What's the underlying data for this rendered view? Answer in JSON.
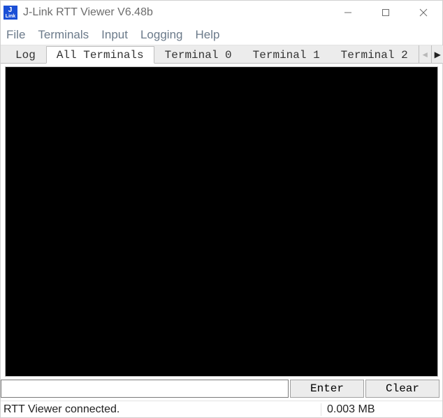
{
  "window": {
    "title": "J-Link RTT Viewer V6.48b"
  },
  "menu": {
    "items": [
      "File",
      "Terminals",
      "Input",
      "Logging",
      "Help"
    ]
  },
  "tabs": {
    "items": [
      "Log",
      "All Terminals",
      "Terminal 0",
      "Terminal 1",
      "Terminal 2"
    ],
    "active_index": 1
  },
  "terminal": {
    "content": ""
  },
  "input": {
    "value": "",
    "enter_label": "Enter",
    "clear_label": "Clear"
  },
  "status": {
    "message": "RTT Viewer connected.",
    "bytes": "0.003 MB"
  }
}
